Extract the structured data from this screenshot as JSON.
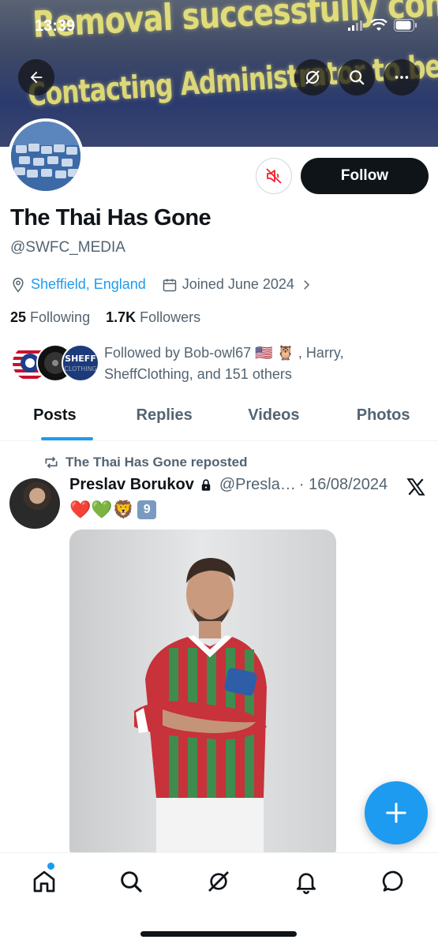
{
  "status": {
    "time": "13:39"
  },
  "banner": {
    "line1": "Removal successfully completed!",
    "line2": "Contacting Administrator to begin recovery..."
  },
  "profile": {
    "display_name": "The Thai Has Gone",
    "handle": "@SWFC_MEDIA",
    "location": "Sheffield, England",
    "joined": "Joined June 2024",
    "following_count": "25",
    "following_label": "Following",
    "followers_count": "1.7K",
    "followers_label": "Followers",
    "followed_by": "Followed by Bob-owl67 🇺🇸 🦉 , Harry, SheffClothing, and 151 others",
    "follow_label": "Follow"
  },
  "tabs": [
    {
      "label": "Posts",
      "active": true
    },
    {
      "label": "Replies",
      "active": false
    },
    {
      "label": "Videos",
      "active": false
    },
    {
      "label": "Photos",
      "active": false
    }
  ],
  "post": {
    "repost_text": "The Thai Has Gone reposted",
    "author_name": "Preslav Borukov",
    "author_handle": "@Presla…",
    "date": "· 16/08/2024",
    "emojis": "❤️💚🦁",
    "keycap": "9"
  },
  "colors": {
    "accent": "#1d9bf0",
    "text_primary": "#0f1419",
    "text_secondary": "#536471"
  },
  "icons": {
    "back": "back-arrow-icon",
    "grok": "grok-icon",
    "search": "search-icon",
    "more": "more-icon",
    "mute": "muted-speaker-icon",
    "location": "location-pin-icon",
    "calendar": "calendar-icon",
    "repost": "repost-icon",
    "lock": "lock-icon",
    "x": "x-logo-icon",
    "compose": "plus-icon"
  }
}
